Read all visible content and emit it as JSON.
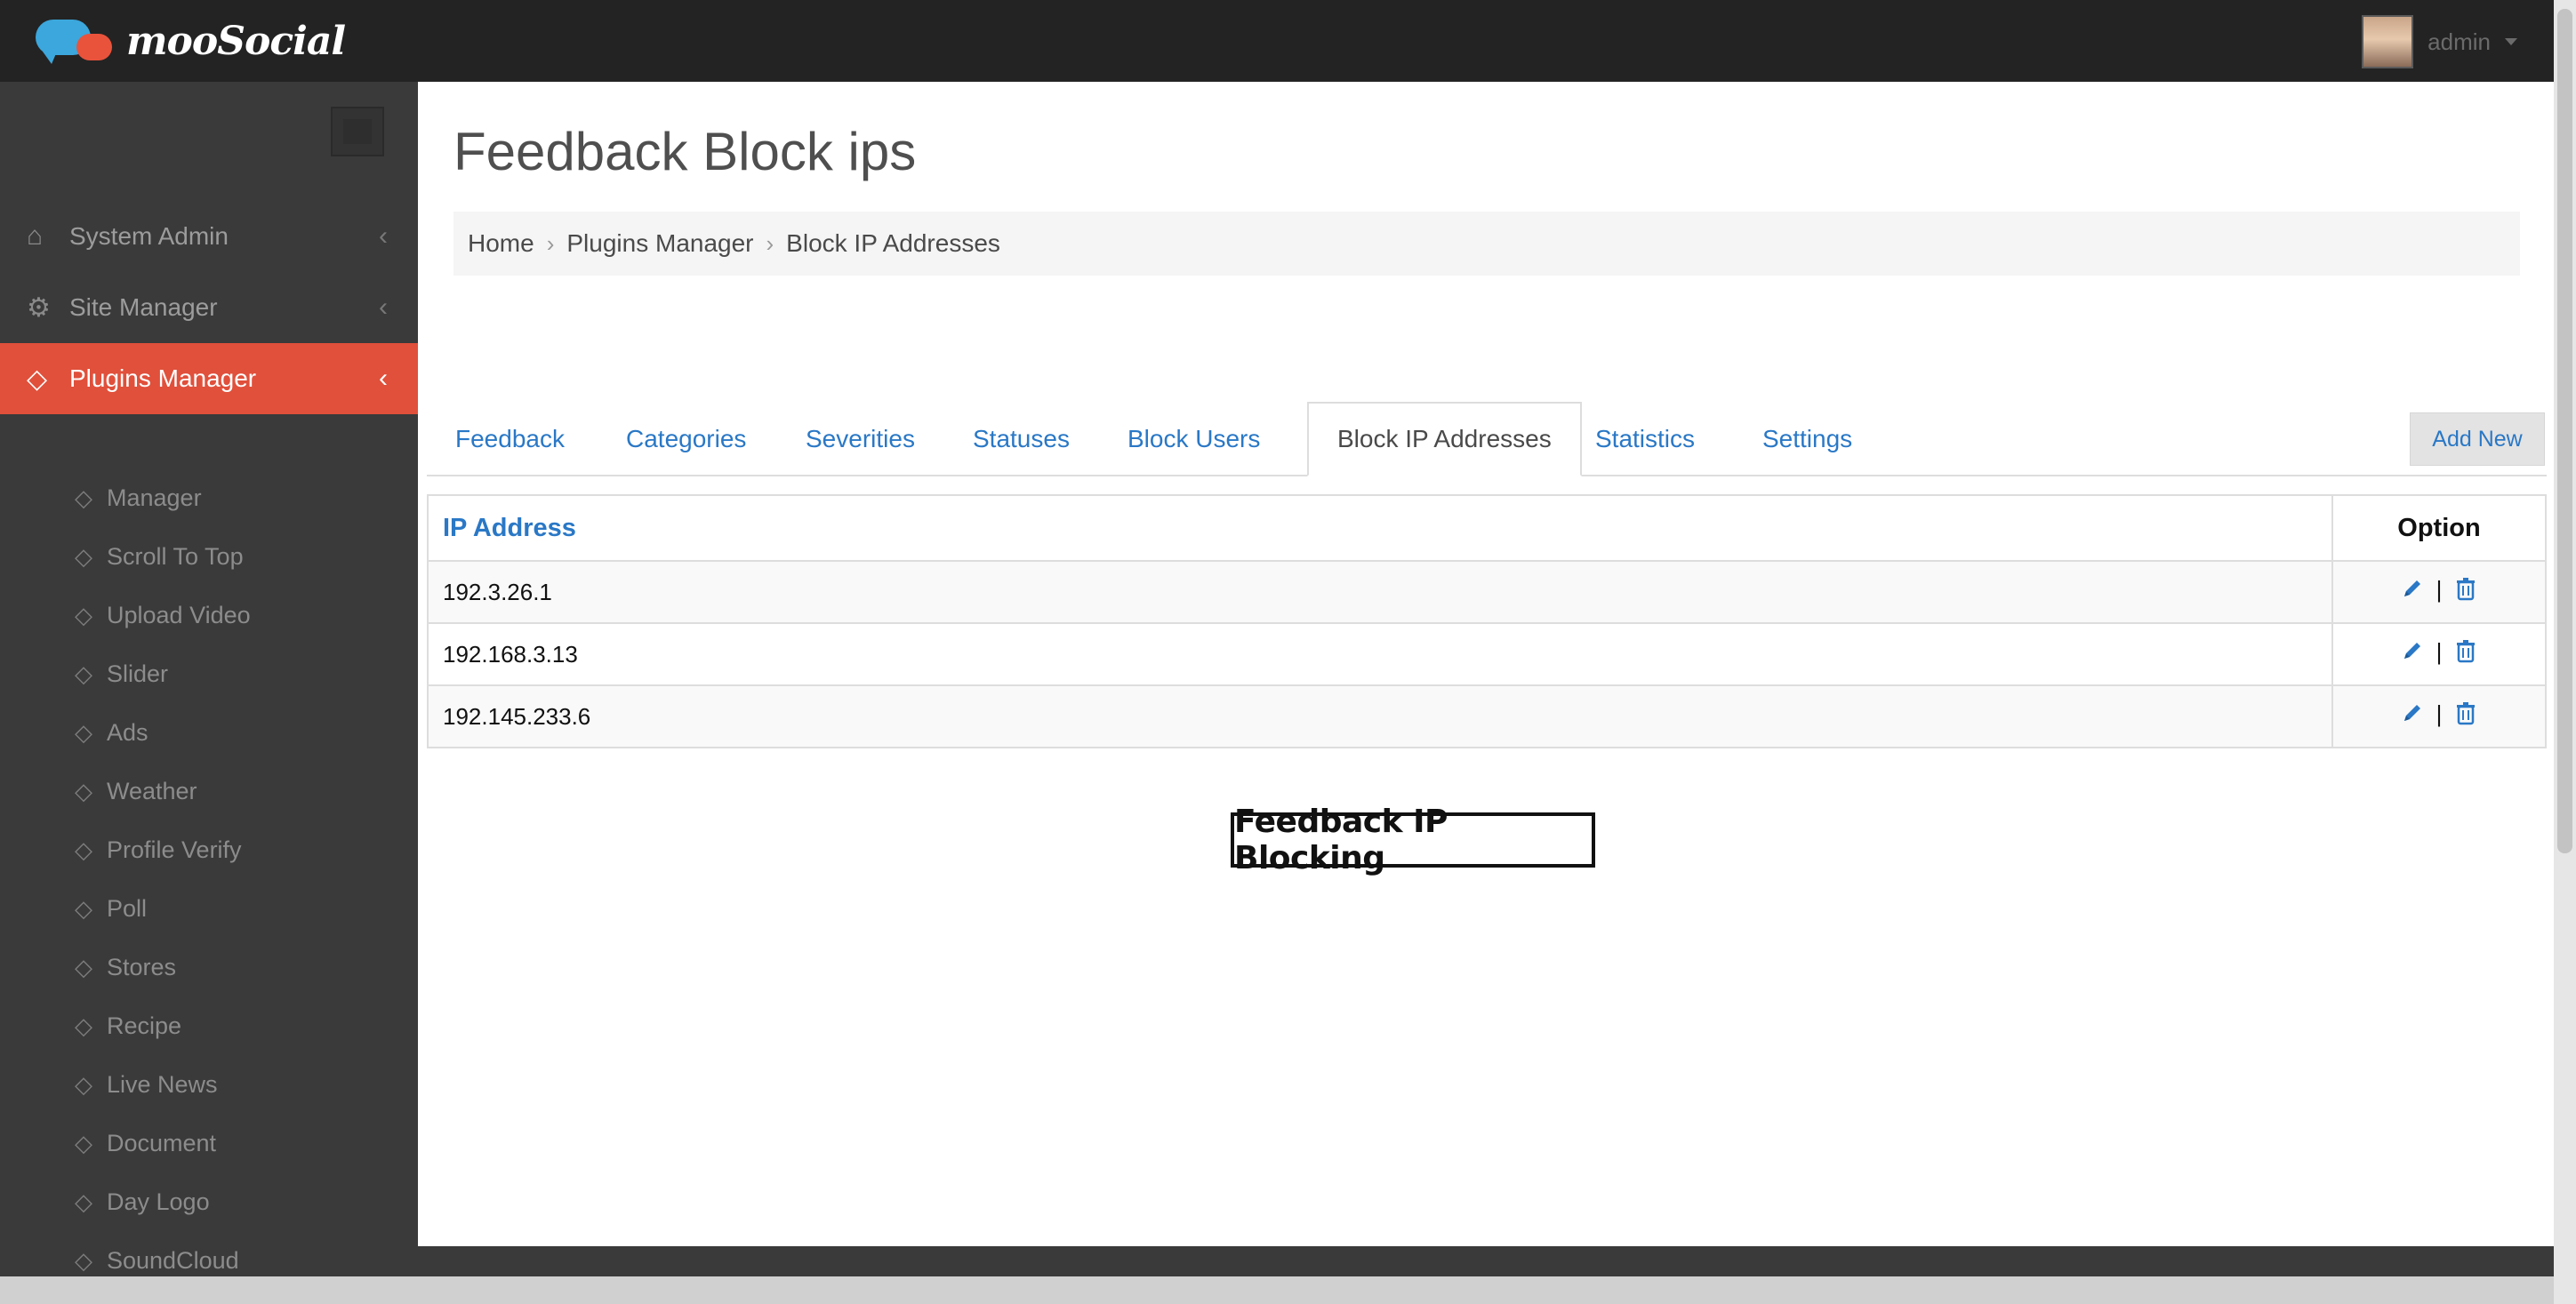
{
  "brand": {
    "logo_text": "mooSocial"
  },
  "user": {
    "name": "admin"
  },
  "sidebar": {
    "items": [
      {
        "label": "System Admin",
        "icon": "home-icon"
      },
      {
        "label": "Site Manager",
        "icon": "gears-icon"
      },
      {
        "label": "Plugins Manager",
        "icon": "tag-icon",
        "active": true
      }
    ],
    "subitems": [
      "Manager",
      "Scroll To Top",
      "Upload Video",
      "Slider",
      "Ads",
      "Weather",
      "Profile Verify",
      "Poll",
      "Stores",
      "Recipe",
      "Live News",
      "Document",
      "Day Logo",
      "SoundCloud"
    ]
  },
  "page": {
    "title": "Feedback Block ips",
    "breadcrumb": [
      "Home",
      "Plugins Manager",
      "Block IP Addresses"
    ]
  },
  "tabs": [
    {
      "label": "Feedback"
    },
    {
      "label": "Categories"
    },
    {
      "label": "Severities"
    },
    {
      "label": "Statuses"
    },
    {
      "label": "Block Users"
    },
    {
      "label": "Block IP Addresses",
      "active": true
    },
    {
      "label": "Statistics"
    },
    {
      "label": "Settings"
    }
  ],
  "actions": {
    "add_new": "Add New"
  },
  "table": {
    "headers": {
      "ip": "IP Address",
      "option": "Option"
    },
    "rows": [
      {
        "ip": "192.3.26.1"
      },
      {
        "ip": "192.168.3.13"
      },
      {
        "ip": "192.145.233.6"
      }
    ],
    "option_separator": "|"
  },
  "stamp": {
    "text": "Feedback IP Blocking"
  },
  "colors": {
    "accent": "#e0503b",
    "link": "#2a78c6",
    "topbar": "#232323",
    "sidebar": "#3a3a3a"
  }
}
